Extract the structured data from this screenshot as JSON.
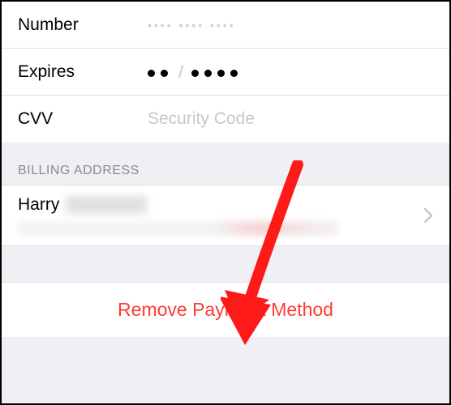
{
  "card": {
    "number_label": "Number",
    "number_masked_dots": "•••• •••• ••••",
    "expires_label": "Expires",
    "expires_month_dots": 2,
    "expires_year_dots": 4,
    "cvv_label": "CVV",
    "cvv_placeholder": "Security Code"
  },
  "billing": {
    "section_title": "BILLING ADDRESS",
    "first_name": "Harry"
  },
  "actions": {
    "remove_label": "Remove Payment Method"
  },
  "colors": {
    "destructive": "#ff3b30",
    "placeholder": "#c7c7cd",
    "section_bg": "#efeff4"
  }
}
